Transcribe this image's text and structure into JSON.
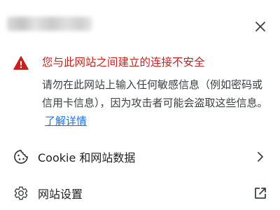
{
  "security_popup": {
    "site_name": "",
    "warning_title": "您与此网站之间建立的连接不安全",
    "warning_body": "请勿在此网站上输入任何敏感信息（例如密码或信用卡信息），因为攻击者可能会盗取这些信息。",
    "learn_more_label": "了解详情",
    "cookie_row_label": "Cookie 和网站数据",
    "site_settings_label": "网站设置",
    "colors": {
      "warning": "#c5221f",
      "link": "#1a73e8",
      "text": "#202124"
    },
    "icons": {
      "close": "close-icon",
      "warning": "warning-triangle-icon",
      "cookie": "cookie-icon",
      "cookie_trailing": "chevron-right-icon",
      "settings": "gear-icon",
      "settings_trailing": "open-in-new-icon"
    }
  }
}
